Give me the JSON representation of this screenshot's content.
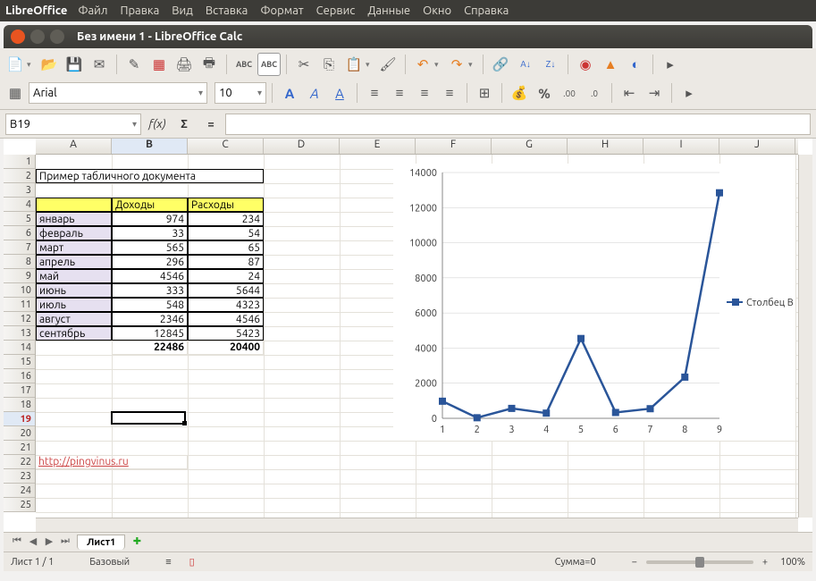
{
  "app_name": "LibreOffice",
  "menubar": [
    "Файл",
    "Правка",
    "Вид",
    "Вставка",
    "Формат",
    "Сервис",
    "Данные",
    "Окно",
    "Справка"
  ],
  "window_title": "Без имени 1 - LibreOffice Calc",
  "font": {
    "name": "Arial",
    "size": "10"
  },
  "cell_ref": "B19",
  "formula_value": "",
  "columns": [
    "A",
    "B",
    "C",
    "D",
    "E",
    "F",
    "G",
    "H",
    "I",
    "J"
  ],
  "selected_column": "B",
  "selected_row": 19,
  "row_count": 25,
  "cell_data": {
    "title_text": "Пример табличного документа",
    "header_b": "Доходы",
    "header_c": "Расходы",
    "rows": [
      {
        "label": "январь",
        "b": "974",
        "c": "234"
      },
      {
        "label": "февраль",
        "b": "33",
        "c": "54"
      },
      {
        "label": "март",
        "b": "565",
        "c": "65"
      },
      {
        "label": "апрель",
        "b": "296",
        "c": "87"
      },
      {
        "label": "май",
        "b": "4546",
        "c": "24"
      },
      {
        "label": "июнь",
        "b": "333",
        "c": "5644"
      },
      {
        "label": "июль",
        "b": "548",
        "c": "4323"
      },
      {
        "label": "август",
        "b": "2346",
        "c": "4546"
      },
      {
        "label": "сентябрь",
        "b": "12845",
        "c": "5423"
      }
    ],
    "total_b": "22486",
    "total_c": "20400",
    "link_text": "http://pingvinus.ru"
  },
  "chart_data": {
    "type": "line",
    "x": [
      1,
      2,
      3,
      4,
      5,
      6,
      7,
      8,
      9
    ],
    "series": [
      {
        "name": "Столбец B",
        "values": [
          974,
          33,
          565,
          296,
          4546,
          333,
          548,
          2346,
          12845
        ]
      }
    ],
    "ylim": [
      0,
      14000
    ],
    "yticks": [
      0,
      2000,
      4000,
      6000,
      8000,
      10000,
      12000,
      14000
    ],
    "xlabel": "",
    "ylabel": "",
    "title": ""
  },
  "sheet_tab": "Лист1",
  "status": {
    "sheets": "Лист 1 / 1",
    "style": "Базовый",
    "sum": "Сумма=0",
    "zoom": "100%"
  }
}
